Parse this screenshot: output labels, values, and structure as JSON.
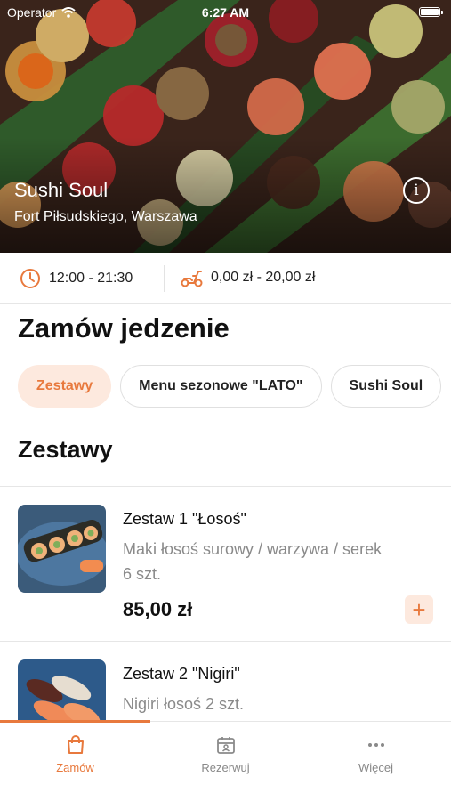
{
  "status_bar": {
    "carrier": "Operator",
    "time": "6:27 AM"
  },
  "header": {
    "restaurant_name": "Sushi Soul",
    "address": "Fort Piłsudskiego, Warszawa",
    "info_icon": "info-icon"
  },
  "info": {
    "hours": "12:00 - 21:30",
    "delivery_fee": "0,00 zł - 20,00 zł"
  },
  "page_title": "Zamów jedzenie",
  "categories": [
    {
      "label": "Zestawy",
      "active": true
    },
    {
      "label": "Menu sezonowe \"LATO\"",
      "active": false
    },
    {
      "label": "Sushi Soul",
      "active": false
    }
  ],
  "section_title": "Zestawy",
  "items": [
    {
      "name": "Zestaw 1 \"Łosoś\"",
      "description_line1": "Maki łosoś surowy / warzywa / serek",
      "description_line2": "6 szt.",
      "price": "85,00 zł",
      "add_label": "+"
    },
    {
      "name": "Zestaw 2 \"Nigiri\"",
      "description_line1": "Nigiri łosoś 2 szt."
    }
  ],
  "tabbar": {
    "tabs": [
      {
        "label": "Zamów",
        "icon": "shopping-bag-icon",
        "active": true
      },
      {
        "label": "Rezerwuj",
        "icon": "calendar-person-icon",
        "active": false
      },
      {
        "label": "Więcej",
        "icon": "more-dots-icon",
        "active": false
      }
    ]
  },
  "colors": {
    "accent": "#e8793d",
    "accent_light": "#fde9de"
  }
}
